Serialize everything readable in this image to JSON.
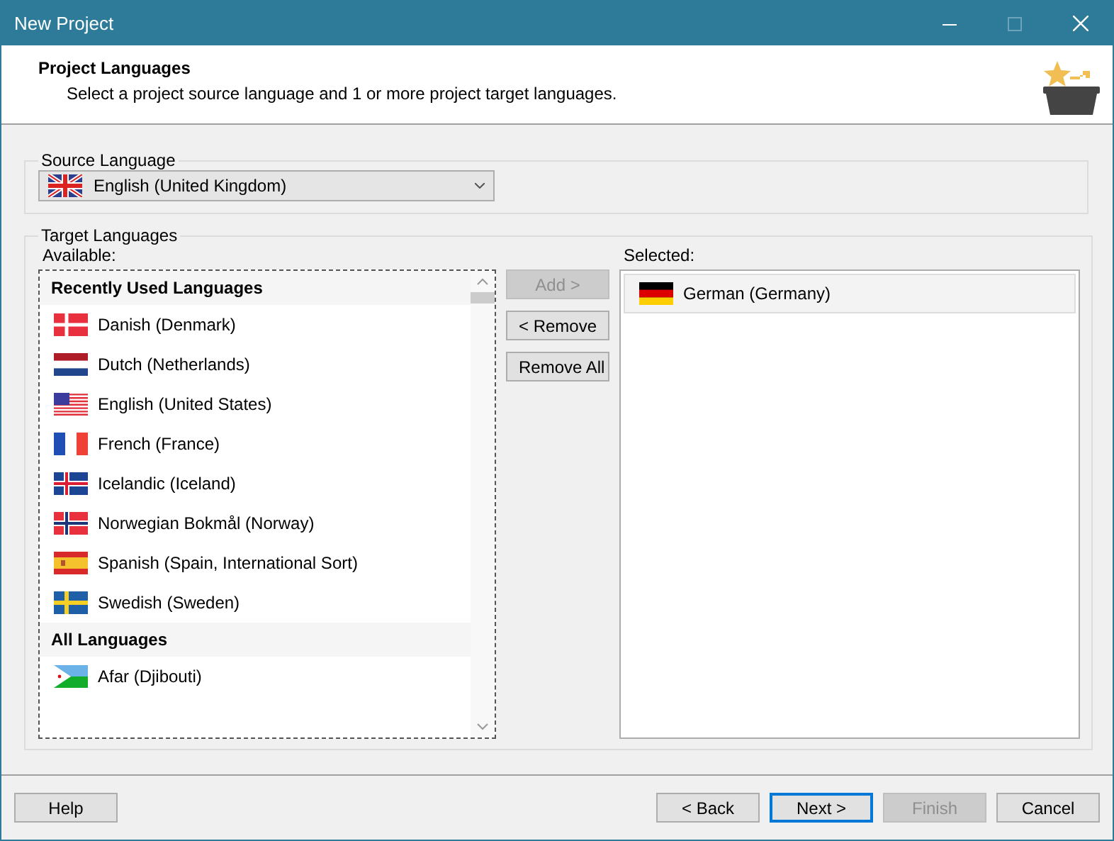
{
  "window": {
    "title": "New Project"
  },
  "header": {
    "title": "Project Languages",
    "description": "Select a project source language and 1 or more project target languages."
  },
  "source_language": {
    "label": "Source Language",
    "value": "English (United Kingdom)",
    "kind": "gb"
  },
  "target_languages": {
    "label": "Target Languages",
    "available": {
      "label": "Available:",
      "groups": [
        {
          "title": "Recently Used Languages",
          "items": [
            {
              "name": "Danish (Denmark)",
              "kind": "dk",
              "selected": false
            },
            {
              "name": "Dutch (Netherlands)",
              "kind": "nl",
              "selected": false
            },
            {
              "name": "English (United States)",
              "kind": "us",
              "selected": false
            },
            {
              "name": "French (France)",
              "kind": "fr",
              "selected": false
            },
            {
              "name": "Icelandic (Iceland)",
              "kind": "is",
              "selected": false
            },
            {
              "name": "Norwegian Bokmål (Norway)",
              "kind": "no",
              "selected": false
            },
            {
              "name": "Spanish (Spain, International Sort)",
              "kind": "es",
              "selected": false
            },
            {
              "name": "Swedish (Sweden)",
              "kind": "se",
              "selected": false
            }
          ]
        },
        {
          "title": "All Languages",
          "items": [
            {
              "name": "Afar (Djibouti)",
              "kind": "dj",
              "selected": false
            }
          ]
        }
      ]
    },
    "actions": [
      {
        "label": "Add >",
        "disabled": true
      },
      {
        "label": "< Remove",
        "disabled": false
      },
      {
        "label": "Remove All",
        "disabled": false
      }
    ],
    "selected": {
      "label": "Selected:",
      "items": [
        {
          "name": "German (Germany)",
          "kind": "de",
          "selected": true
        }
      ]
    }
  },
  "help_button": {
    "label": "Help",
    "disabled": false,
    "default": false
  },
  "buttons": [
    {
      "label": "< Back",
      "disabled": false,
      "default": false
    },
    {
      "label": "Next >",
      "disabled": false,
      "default": true
    },
    {
      "label": "Finish",
      "disabled": true,
      "default": false
    },
    {
      "label": "Cancel",
      "disabled": false,
      "default": false
    }
  ]
}
